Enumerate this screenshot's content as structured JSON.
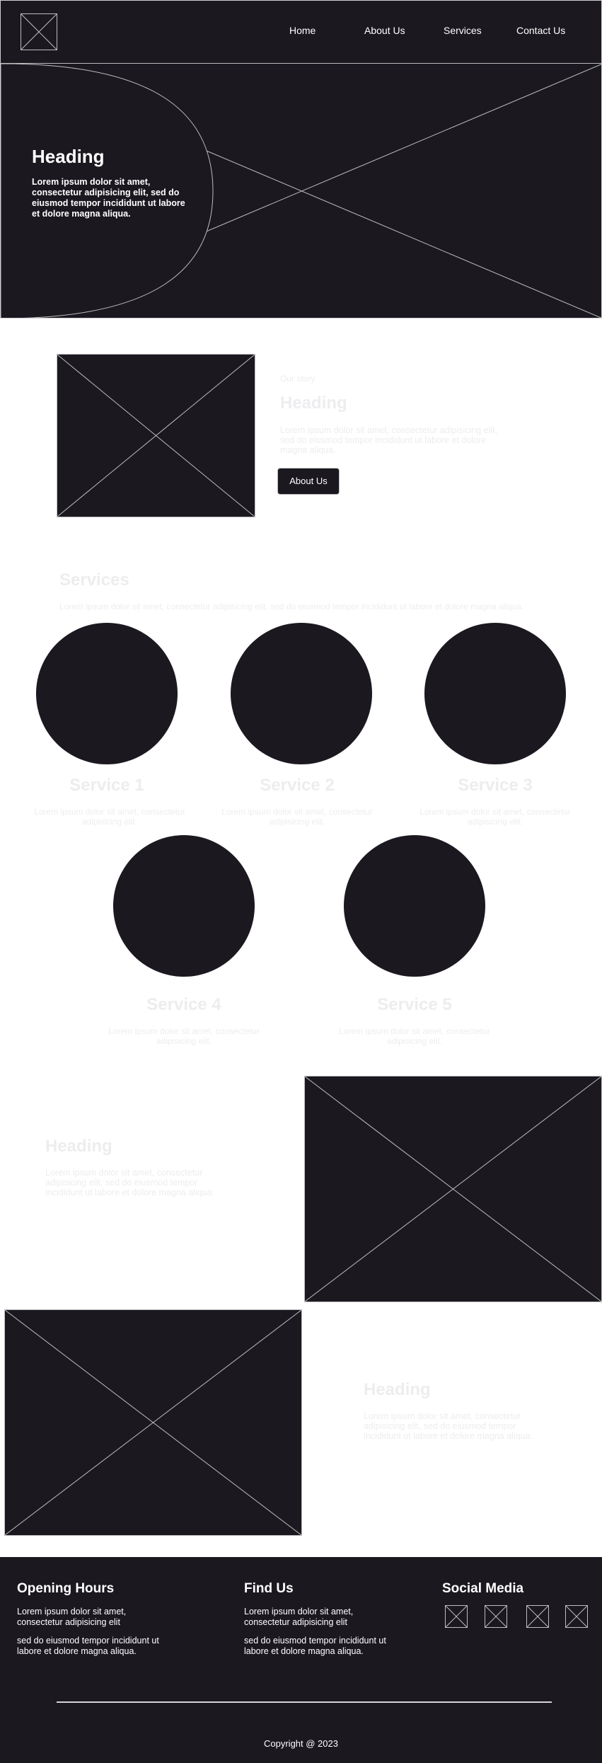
{
  "nav": {
    "items": [
      "Home",
      "About Us",
      "Services",
      "Contact Us"
    ]
  },
  "hero": {
    "heading": "Heading",
    "text": "Lorem ipsum dolor sit amet, consectetur adipisicing elit, sed do eiusmod tempor incididunt ut labore et dolore magna aliqua."
  },
  "about": {
    "eyebrow": "Our story",
    "heading": "Heading",
    "text": "Lorem ipsum dolor sit amet, consectetur adipisicing elit, sed do eiusmod tempor incididunt ut labore et dolore magna aliqua.",
    "button": "About Us"
  },
  "services": {
    "heading": "Services",
    "subtitle": "Lorem ipsum dolor sit amet, consectetur adipisicing elit, sed do eiusmod tempor incididunt ut labore et dolore magna aliqua.",
    "items": [
      {
        "title": "Service 1",
        "text": "Lorem ipsum dolor sit amet, consectetur adipisicing elit."
      },
      {
        "title": "Service 2",
        "text": "Lorem ipsum dolor sit amet, consectetur adipisicing elit."
      },
      {
        "title": "Service 3",
        "text": "Lorem ipsum dolor sit amet, consectetur adipisicing elit."
      },
      {
        "title": "Service 4",
        "text": "Lorem ipsum dolor sit amet, consectetur adipisicing elit."
      },
      {
        "title": "Service 5",
        "text": "Lorem ipsum dolor sit amet, consectetur adipisicing elit."
      }
    ]
  },
  "feature_1": {
    "heading": "Heading",
    "text": "Lorem ipsum dolor sit amet, consectetur adipisicing elit, sed do eiusmod tempor incididunt ut labore et dolore magna aliqua."
  },
  "feature_2": {
    "heading": "Heading",
    "text": "Lorem ipsum dolor sit amet, consectetur adipisicing elit, sed do eiusmod tempor incididunt ut labore et dolore magna aliqua."
  },
  "footer": {
    "hours": {
      "heading": "Opening Hours",
      "line1": "Lorem ipsum dolor sit amet, consectetur adipisicing elit",
      "line2": "sed do eiusmod tempor incididunt ut labore et dolore magna aliqua."
    },
    "find": {
      "heading": "Find Us",
      "line1": "Lorem ipsum dolor sit amet, consectetur adipisicing elit",
      "line2": "sed do eiusmod tempor incididunt ut labore et dolore magna aliqua."
    },
    "social": {
      "heading": "Social Media",
      "icons": [
        "social-icon-placeholder",
        "social-icon-placeholder",
        "social-icon-placeholder",
        "social-icon-placeholder"
      ]
    },
    "copyright": "Copyright @ 2023"
  },
  "colors": {
    "dark": "#1b1820",
    "placeholder_line": "#bdbdbd",
    "faded_text": "#ededef"
  }
}
